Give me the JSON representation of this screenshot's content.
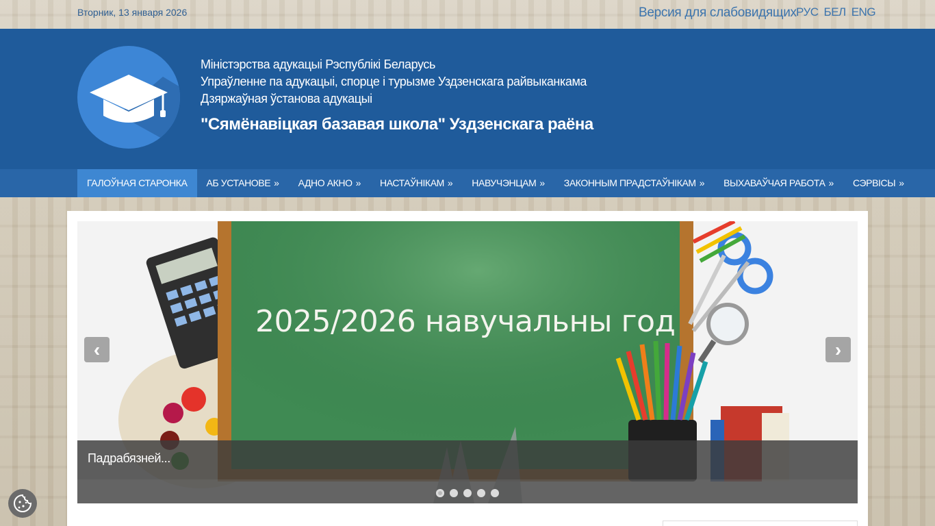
{
  "topbar": {
    "date": "Вторник, 13 января 2026",
    "low_vision_link": "Версия для слабовидящих",
    "languages": [
      "РУС",
      "БЕЛ",
      "ENG"
    ]
  },
  "header": {
    "line1": "Міністэрства адукацыі Рэспублікі Беларусь",
    "line2": "Упраўленне па адукацыі, спорце і турызме Уздзенскага райвыканкама",
    "line3": "Дзяржаўная ўстанова адукацыі",
    "school_name": "\"Сямёнавіцкая базавая школа\" Уздзенскага раёна",
    "logo_icon": "graduation-cap-icon"
  },
  "nav": {
    "items": [
      {
        "label": "ГАЛОЎНАЯ СТАРОНКА",
        "arrow": ""
      },
      {
        "label": "АБ УСТАНОВЕ",
        "arrow": "»"
      },
      {
        "label": "АДНО АКНО",
        "arrow": "»"
      },
      {
        "label": "НАСТАЎНІКАМ",
        "arrow": "»"
      },
      {
        "label": "НАВУЧЭНЦАМ",
        "arrow": "»"
      },
      {
        "label": "ЗАКОННЫМ ПРАДСТАЎНІКАМ",
        "arrow": "»"
      },
      {
        "label": "ВЫХАВАЎЧАЯ РАБОТА",
        "arrow": "»"
      },
      {
        "label": "СЭРВІСЫ",
        "arrow": "»"
      }
    ]
  },
  "slider": {
    "slide_text": "2025/2026 навучальны год",
    "caption": "Падрабязней...",
    "prev_label": "‹",
    "next_label": "›",
    "slide_count": 5,
    "active_slide": 1
  },
  "colors": {
    "header_bg": "#1f5b9b",
    "nav_bg": "#2966a8",
    "nav_active": "#3e87d2",
    "link": "#3c74ad"
  }
}
